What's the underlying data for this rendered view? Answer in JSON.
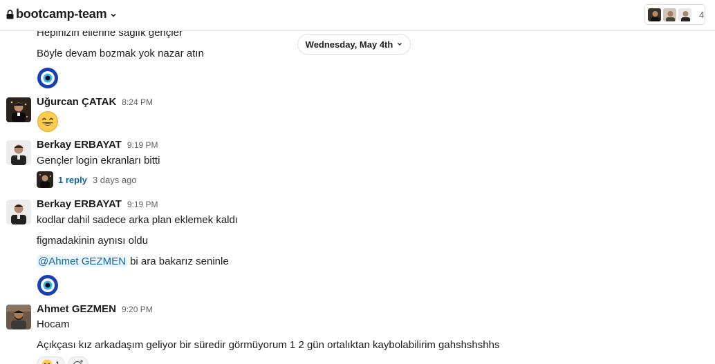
{
  "header": {
    "channel": "bootcamp-team",
    "member_count": "4"
  },
  "date_divider": "Wednesday, May 4th",
  "messages": [
    {
      "lines": [
        "Hepinizin ellerine sağlık gençler",
        "Böyle devam bozmak yok nazar atın"
      ],
      "emoji": "nazar-boncugu"
    },
    {
      "sender": "Uğurcan ÇATAK",
      "time": "8:24 PM",
      "emoji": "smile"
    },
    {
      "sender": "Berkay ERBAYAT",
      "time": "9:19 PM",
      "text": "Gençler login ekranları bitti",
      "thread": {
        "replies": "1 reply",
        "ago": "3 days ago"
      }
    },
    {
      "sender": "Berkay ERBAYAT",
      "time": "9:19 PM",
      "lines": [
        "kodlar dahil sadece arka plan eklemek kaldı",
        "figmadakinin aynısı oldu"
      ],
      "mention": "@Ahmet GEZMEN",
      "mention_rest": " bi ara bakarız seninle",
      "emoji": "nazar-boncugu"
    },
    {
      "sender": "Ahmet GEZMEN",
      "time": "9:20 PM",
      "lines": [
        "Hocam",
        "Açıkçası kız arkadaşım geliyor bir süredir görmüyorum 1 2 gün ortalıktan kaybolabilirim gahshshshhs"
      ],
      "reactions": [
        {
          "icon": "smirk-emoji",
          "count": "1"
        }
      ]
    }
  ],
  "colors": {
    "link": "#1264a3",
    "mention_bg": "#e8f5fa",
    "muted": "#616061"
  }
}
